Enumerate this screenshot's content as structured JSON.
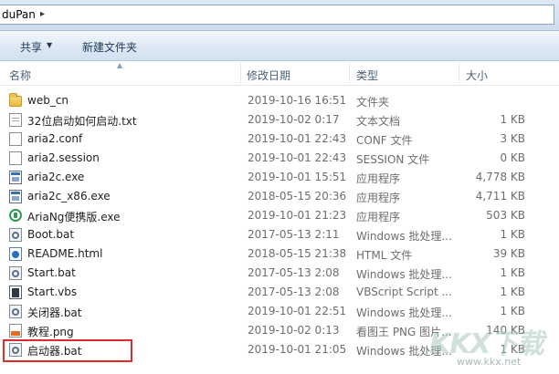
{
  "address_bar": {
    "path_text": "duPan"
  },
  "toolbar": {
    "share_label": "共享",
    "new_folder_label": "新建文件夹"
  },
  "columns": {
    "name": "名称",
    "date": "修改日期",
    "type": "类型",
    "size": "大小"
  },
  "files": [
    {
      "name": "web_cn",
      "date": "2019-10-16 16:51",
      "type": "文件夹",
      "size": "",
      "icon": "folder-icon"
    },
    {
      "name": "32位启动如何启动.txt",
      "date": "2019-10-02 0:17",
      "type": "文本文档",
      "size": "1 KB",
      "icon": "text-document-icon"
    },
    {
      "name": "aria2.conf",
      "date": "2019-10-01 22:43",
      "type": "CONF 文件",
      "size": "3 KB",
      "icon": "blank-file-icon"
    },
    {
      "name": "aria2.session",
      "date": "2019-10-01 22:43",
      "type": "SESSION 文件",
      "size": "0 KB",
      "icon": "blank-file-icon"
    },
    {
      "name": "aria2c.exe",
      "date": "2019-10-01 15:51",
      "type": "应用程序",
      "size": "4,778 KB",
      "icon": "exe-icon"
    },
    {
      "name": "aria2c_x86.exe",
      "date": "2018-05-15 20:36",
      "type": "应用程序",
      "size": "4,711 KB",
      "icon": "exe-icon"
    },
    {
      "name": "AriaNg便携版.exe",
      "date": "2019-10-01 21:23",
      "type": "应用程序",
      "size": "503 KB",
      "icon": "ariang-icon"
    },
    {
      "name": "Boot.bat",
      "date": "2017-05-13 2:11",
      "type": "Windows 批处理...",
      "size": "1 KB",
      "icon": "batch-file-icon"
    },
    {
      "name": "README.html",
      "date": "2018-05-15 21:38",
      "type": "HTML 文件",
      "size": "39 KB",
      "icon": "html-file-icon"
    },
    {
      "name": "Start.bat",
      "date": "2017-05-13 2:08",
      "type": "Windows 批处理...",
      "size": "1 KB",
      "icon": "batch-file-icon"
    },
    {
      "name": "Start.vbs",
      "date": "2017-05-13 2:08",
      "type": "VBScript Script ...",
      "size": "1 KB",
      "icon": "vbscript-icon"
    },
    {
      "name": "关闭器.bat",
      "date": "2019-10-01 22:51",
      "type": "Windows 批处理...",
      "size": "1 KB",
      "icon": "batch-file-icon"
    },
    {
      "name": "教程.png",
      "date": "2019-10-02 0:13",
      "type": "看图王 PNG 图片...",
      "size": "140 KB",
      "icon": "png-image-icon"
    },
    {
      "name": "启动器.bat",
      "date": "2019-10-01 21:05",
      "type": "Windows 批处理...",
      "size": "1 KB",
      "icon": "batch-file-icon"
    }
  ],
  "watermark": {
    "logo_text": "KKX下载",
    "url": "www.kkx.net"
  },
  "colors": {
    "highlight_box": "#e02b2b",
    "toolbar_text": "#1e395b"
  }
}
